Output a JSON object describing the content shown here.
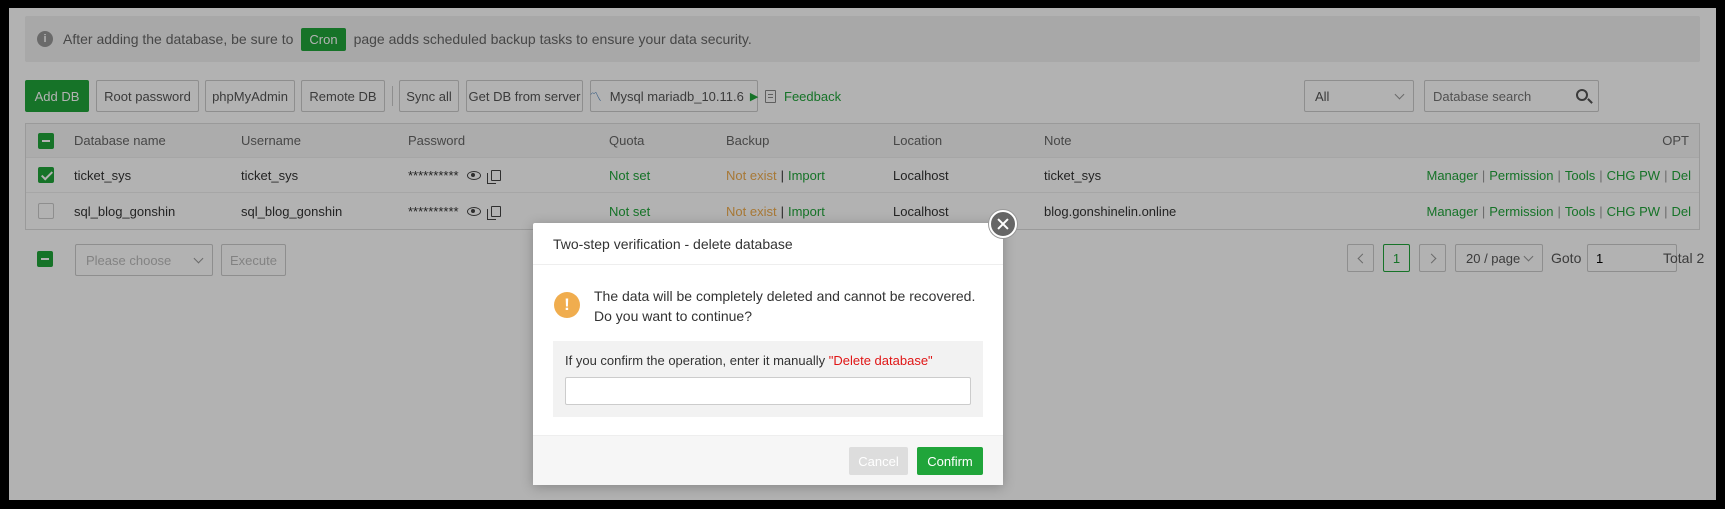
{
  "notice": {
    "text_before": "After adding the database, be sure to",
    "cron_label": "Cron",
    "text_after": "page adds scheduled backup tasks to ensure your data security."
  },
  "toolbar": {
    "add_db": "Add DB",
    "root_password": "Root password",
    "phpmyadmin": "phpMyAdmin",
    "remote_db": "Remote DB",
    "sync_all": "Sync all",
    "get_db_from_server": "Get DB from server",
    "mysql_version": "Mysql mariadb_10.11.6",
    "feedback": "Feedback",
    "filter_value": "All",
    "search_placeholder": "Database search"
  },
  "table": {
    "headers": {
      "name": "Database name",
      "username": "Username",
      "password": "Password",
      "quota": "Quota",
      "backup": "Backup",
      "location": "Location",
      "note": "Note",
      "opt": "OPT"
    },
    "rows": [
      {
        "name": "ticket_sys",
        "username": "ticket_sys",
        "password": "**********",
        "quota": "Not set",
        "backup_status": "Not exist",
        "backup_import": "Import",
        "location": "Localhost",
        "note": "ticket_sys",
        "checked": true
      },
      {
        "name": "sql_blog_gonshin",
        "username": "sql_blog_gonshin",
        "password": "**********",
        "quota": "Not set",
        "backup_status": "Not exist",
        "backup_import": "Import",
        "location": "Localhost",
        "note": "blog.gonshinelin.online",
        "checked": false
      }
    ],
    "ops": {
      "manager": "Manager",
      "permission": "Permission",
      "tools": "Tools",
      "chg_pw": "CHG PW",
      "del": "Del",
      "separator": "|"
    },
    "backup_separator": "|"
  },
  "footer": {
    "batch_placeholder": "Please choose",
    "execute": "Execute",
    "current_page": "1",
    "per_page": "20 / page",
    "goto_label": "Goto",
    "goto_value": "1",
    "total": "Total 2"
  },
  "modal": {
    "title": "Two-step verification - delete database",
    "warning_glyph": "!",
    "message": "The data will be completely deleted and cannot be recovered. Do you want to continue?",
    "confirm_prefix": "If you confirm the operation, enter it manually ",
    "confirm_phrase": "\"Delete database\"",
    "input_value": "",
    "cancel": "Cancel",
    "confirm": "Confirm"
  },
  "colors": {
    "brand_green": "#20a53a",
    "warning_orange": "#f0ad4e",
    "danger_red": "#e01616"
  }
}
